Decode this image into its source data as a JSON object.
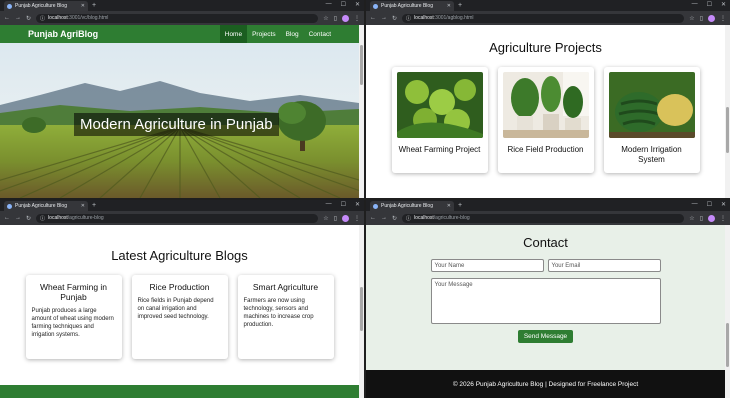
{
  "windows": {
    "home": {
      "tab_title": "Punjab Agriculture Blog",
      "url_host": "localhost",
      "url_rest": ":3001/vc/blog.html",
      "site": {
        "brand": "Punjab AgriBlog",
        "nav": [
          "Home",
          "Projects",
          "Blog",
          "Contact"
        ],
        "hero_title": "Modern Agriculture in Punjab"
      }
    },
    "projects": {
      "tab_title": "Punjab Agriculture Blog",
      "url_host": "localhost",
      "url_rest": ":3001/agblog.html",
      "section_title": "Agriculture Projects",
      "cards": [
        {
          "name": "Wheat Farming Project",
          "image": "green-fruits-image"
        },
        {
          "name": "Rice Field Production",
          "image": "potted-plants-image"
        },
        {
          "name": "Modern Irrigation System",
          "image": "watermelon-image"
        }
      ]
    },
    "blogs": {
      "tab_title": "Punjab Agriculture Blog",
      "url_host": "localhost",
      "url_rest": "/agriculture-blog",
      "section_title": "Latest Agriculture Blogs",
      "posts": [
        {
          "title": "Wheat Farming in Punjab",
          "text": "Punjab produces a large amount of wheat using modern farming techniques and irrigation systems."
        },
        {
          "title": "Rice Production",
          "text": "Rice fields in Punjab depend on canal irrigation and improved seed technology."
        },
        {
          "title": "Smart Agriculture",
          "text": "Farmers are now using technology, sensors and machines to increase crop production."
        }
      ]
    },
    "contact": {
      "tab_title": "Punjab Agriculture Blog",
      "url_host": "localhost",
      "url_rest": "/agriculture-blog",
      "section_title": "Contact",
      "name_placeholder": "Your Name",
      "email_placeholder": "Your Email",
      "message_placeholder": "Your Message",
      "send_label": "Send Message",
      "footer_text": "© 2026 Punjab Agriculture Blog | Designed for Freelance Project"
    }
  },
  "colors": {
    "brand_green": "#2e7d32",
    "active_nav": "#1b5e20",
    "contact_bg": "#e8f0e8"
  }
}
